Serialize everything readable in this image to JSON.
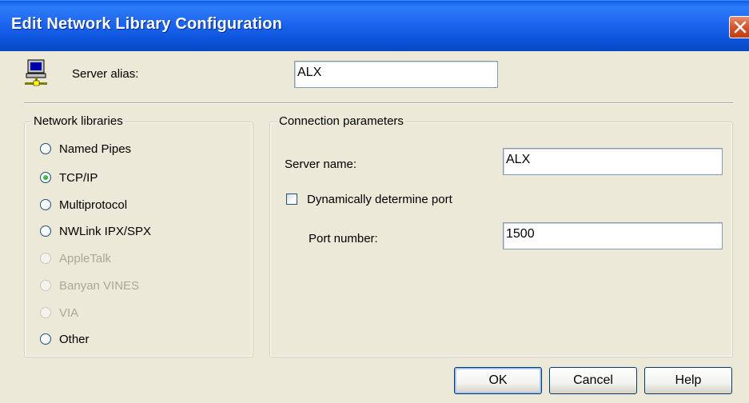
{
  "window": {
    "title": "Edit Network Library Configuration"
  },
  "alias": {
    "label": "Server alias:",
    "value": "ALX",
    "icon": "computer-network-icon"
  },
  "libraries": {
    "legend": "Network libraries",
    "selected": "TCP/IP",
    "options": [
      {
        "label": "Named Pipes",
        "checked": false,
        "enabled": true
      },
      {
        "label": "TCP/IP",
        "checked": true,
        "enabled": true
      },
      {
        "label": "Multiprotocol",
        "checked": false,
        "enabled": true
      },
      {
        "label": "NWLink IPX/SPX",
        "checked": false,
        "enabled": true
      },
      {
        "label": "AppleTalk",
        "checked": false,
        "enabled": false
      },
      {
        "label": "Banyan VINES",
        "checked": false,
        "enabled": false
      },
      {
        "label": "VIA",
        "checked": false,
        "enabled": false
      },
      {
        "label": "Other",
        "checked": false,
        "enabled": true
      }
    ]
  },
  "connection": {
    "legend": "Connection parameters",
    "server_name_label": "Server name:",
    "server_name_value": "ALX",
    "dynamic_port_label": "Dynamically determine port",
    "dynamic_port_checked": false,
    "port_label": "Port number:",
    "port_value": "1500"
  },
  "buttons": {
    "ok": "OK",
    "cancel": "Cancel",
    "help": "Help"
  }
}
